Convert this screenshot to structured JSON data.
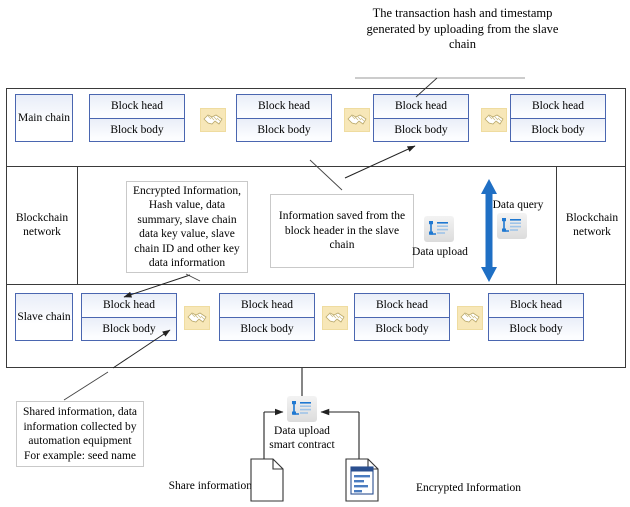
{
  "diagram": {
    "title_note": "The transaction hash and timestamp generated by uploading from the slave chain",
    "colors": {
      "block_border": "#4a66b0",
      "frame": "#3a3a3a",
      "arrow_blue": "#1f6fc4",
      "handshake_bg": "#f7e7b8",
      "icon_blue": "#1f78d1"
    }
  },
  "rows": {
    "main_chain": {
      "label": "Main chain",
      "blocks": [
        {
          "head": "Block head",
          "body": "Block body"
        },
        {
          "head": "Block head",
          "body": "Block body"
        },
        {
          "head": "Block head",
          "body": "Block body"
        },
        {
          "head": "Block head",
          "body": "Block body"
        }
      ],
      "connector_icon": "handshake-icon"
    },
    "network": {
      "left_label": "Blockchain network",
      "right_label": "Blockchain network",
      "encrypted_note": "Encrypted Information, Hash value, data summary, slave chain data key value, slave chain ID and other key data information",
      "saved_note": "Information saved from the block header in the slave chain",
      "data_upload_label": "Data upload",
      "data_query_label": "Data query"
    },
    "slave_chain": {
      "label": "Slave chain",
      "blocks": [
        {
          "head": "Block head",
          "body": "Block body"
        },
        {
          "head": "Block head",
          "body": "Block body"
        },
        {
          "head": "Block head",
          "body": "Block body"
        },
        {
          "head": "Block head",
          "body": "Block body"
        }
      ],
      "connector_icon": "handshake-icon"
    }
  },
  "bottom": {
    "shared_note": "Shared information, data information collected by automation equipment For example: seed name",
    "smart_contract_label": "Data upload smart contract",
    "share_information_label": "Share information",
    "encrypted_information_label": "Encrypted Information"
  }
}
